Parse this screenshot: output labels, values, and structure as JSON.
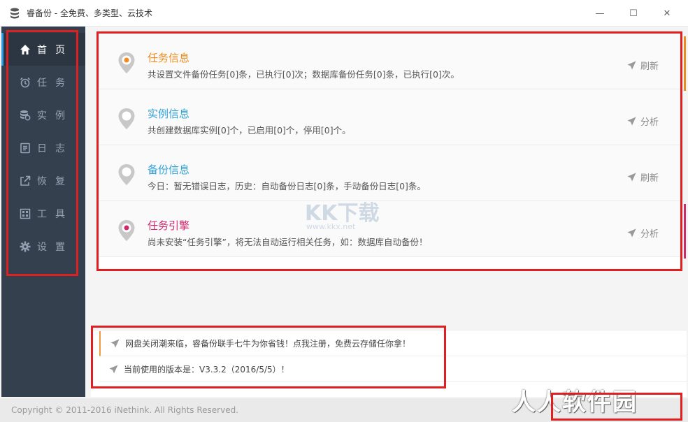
{
  "window": {
    "title": "睿备份 - 全免费、多类型、云技术",
    "minimize": "—",
    "maximize": "☐",
    "close": "✕"
  },
  "sidebar": {
    "items": [
      {
        "label": "首页",
        "icon": "home-icon",
        "active": true
      },
      {
        "label": "任务",
        "icon": "alarm-clock-icon"
      },
      {
        "label": "实例",
        "icon": "database-icon"
      },
      {
        "label": "日志",
        "icon": "log-icon"
      },
      {
        "label": "恢复",
        "icon": "share-icon"
      },
      {
        "label": "工具",
        "icon": "tools-icon"
      },
      {
        "label": "设置",
        "icon": "gear-icon"
      }
    ]
  },
  "cards": [
    {
      "title": "任务信息",
      "desc": "共设置文件备份任务[0]条，已执行[0]次；数据库备份任务[0]条，已执行[0]次。",
      "action": "刷新",
      "color": "#f08c1e",
      "dot": "#f08c1e"
    },
    {
      "title": "实例信息",
      "desc": "共创建数据库实例[0]个，已启用[0]个，停用[0]个。",
      "action": "分析",
      "color": "#2fa0d8",
      "dot": "#ffffff"
    },
    {
      "title": "备份信息",
      "desc": "今日：暂无错误日志，历史：自动备份日志[0]条，手动备份日志[0]条。",
      "action": "刷新",
      "color": "#2fa0d8",
      "dot": "#ffffff"
    },
    {
      "title": "任务引擎",
      "desc": "尚未安装“任务引擎”，将无法自动运行相关任务，如：数据库自动备份！",
      "action": "分析",
      "color": "#d2286e",
      "dot": "#d2286e"
    }
  ],
  "notices": [
    "网盘关闭潮来临，睿备份联手七牛为你省钱！点我注册，免费云存储任你拿！",
    "当前使用的版本是：V3.3.2（2016/5/5）！"
  ],
  "watermark": {
    "text": "KK下载",
    "url": "www.kkx.net"
  },
  "footer": {
    "copyright": "Copyright © 2011-2016 iNethink. All Rights Reserved.",
    "brand_mark": "人人软件园"
  }
}
